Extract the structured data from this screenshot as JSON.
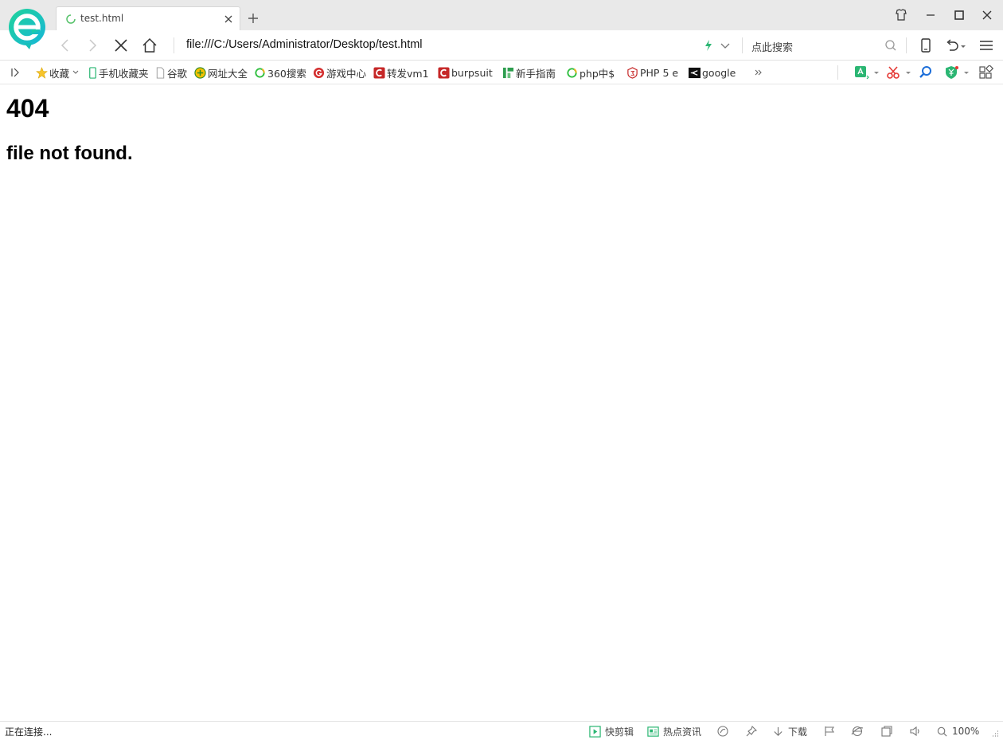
{
  "tab": {
    "title": "test.html"
  },
  "address": {
    "url": "file:///C:/Users/Administrator/Desktop/test.html",
    "search_placeholder": "点此搜索"
  },
  "bookmarks": [
    {
      "label": "收藏",
      "icon": "star-icon"
    },
    {
      "label": "手机收藏夹",
      "icon": "phone-icon"
    },
    {
      "label": "谷歌",
      "icon": "page-icon"
    },
    {
      "label": "网址大全",
      "icon": "navigation-icon"
    },
    {
      "label": "360搜索",
      "icon": "360-search-icon"
    },
    {
      "label": "游戏中心",
      "icon": "game-icon"
    },
    {
      "label": "转发vm1",
      "icon": "c-logo-icon"
    },
    {
      "label": "burpsuit",
      "icon": "c-logo-icon"
    },
    {
      "label": "新手指南",
      "icon": "guide-icon"
    },
    {
      "label": "php中$",
      "icon": "360-search-icon"
    },
    {
      "label": "PHP 5 e",
      "icon": "shield-icon"
    },
    {
      "label": "google",
      "icon": "google-icon"
    }
  ],
  "page": {
    "heading": "404",
    "message": "file not found."
  },
  "status": {
    "text": "正在连接...",
    "items": [
      {
        "label": "快剪辑",
        "icon": "video-icon"
      },
      {
        "label": "热点资讯",
        "icon": "news-icon"
      },
      {
        "label": "下载",
        "icon": "download-icon"
      },
      {
        "label": "100%",
        "icon": "zoom-icon"
      }
    ]
  },
  "colors": {
    "accent_green": "#2bb673",
    "brand_teal": "#1fc8a8",
    "bookmark_red": "#d32f2f"
  }
}
